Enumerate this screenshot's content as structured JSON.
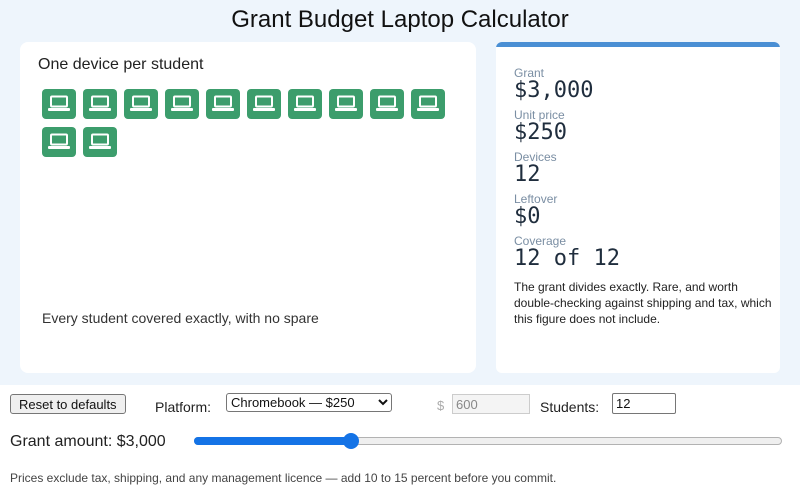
{
  "title": "Grant Budget Laptop Calculator",
  "panel": {
    "heading": "One device per student",
    "device_count": 12,
    "note": "Every student covered exactly, with no spare"
  },
  "stats": {
    "grant_label": "Grant",
    "grant_value": "$3,000",
    "unit_price_label": "Unit price",
    "unit_price_value": "$250",
    "devices_label": "Devices",
    "devices_value": "12",
    "leftover_label": "Leftover",
    "leftover_value": "$0",
    "coverage_label": "Coverage",
    "coverage_value": "12 of 12",
    "description": "The grant divides exactly. Rare, and worth double-checking against shipping and tax, which this figure does not include."
  },
  "controls": {
    "reset_label": "Reset to defaults",
    "platform_label": "Platform:",
    "platform_selected": "Chromebook — $250",
    "price_prefix": "$",
    "custom_price": "600",
    "students_label": "Students:",
    "students_value": "12",
    "grant_amount_label": "Grant amount: $3,000",
    "slider_fraction": 0.267,
    "footnote": "Prices exclude tax, shipping, and any management licence — add 10 to 15 percent before you commit."
  },
  "colors": {
    "device": "#3c9d6c",
    "accent": "#4a8fd4",
    "slider": "#1473e6"
  },
  "icons": {
    "device": "laptop-icon"
  }
}
